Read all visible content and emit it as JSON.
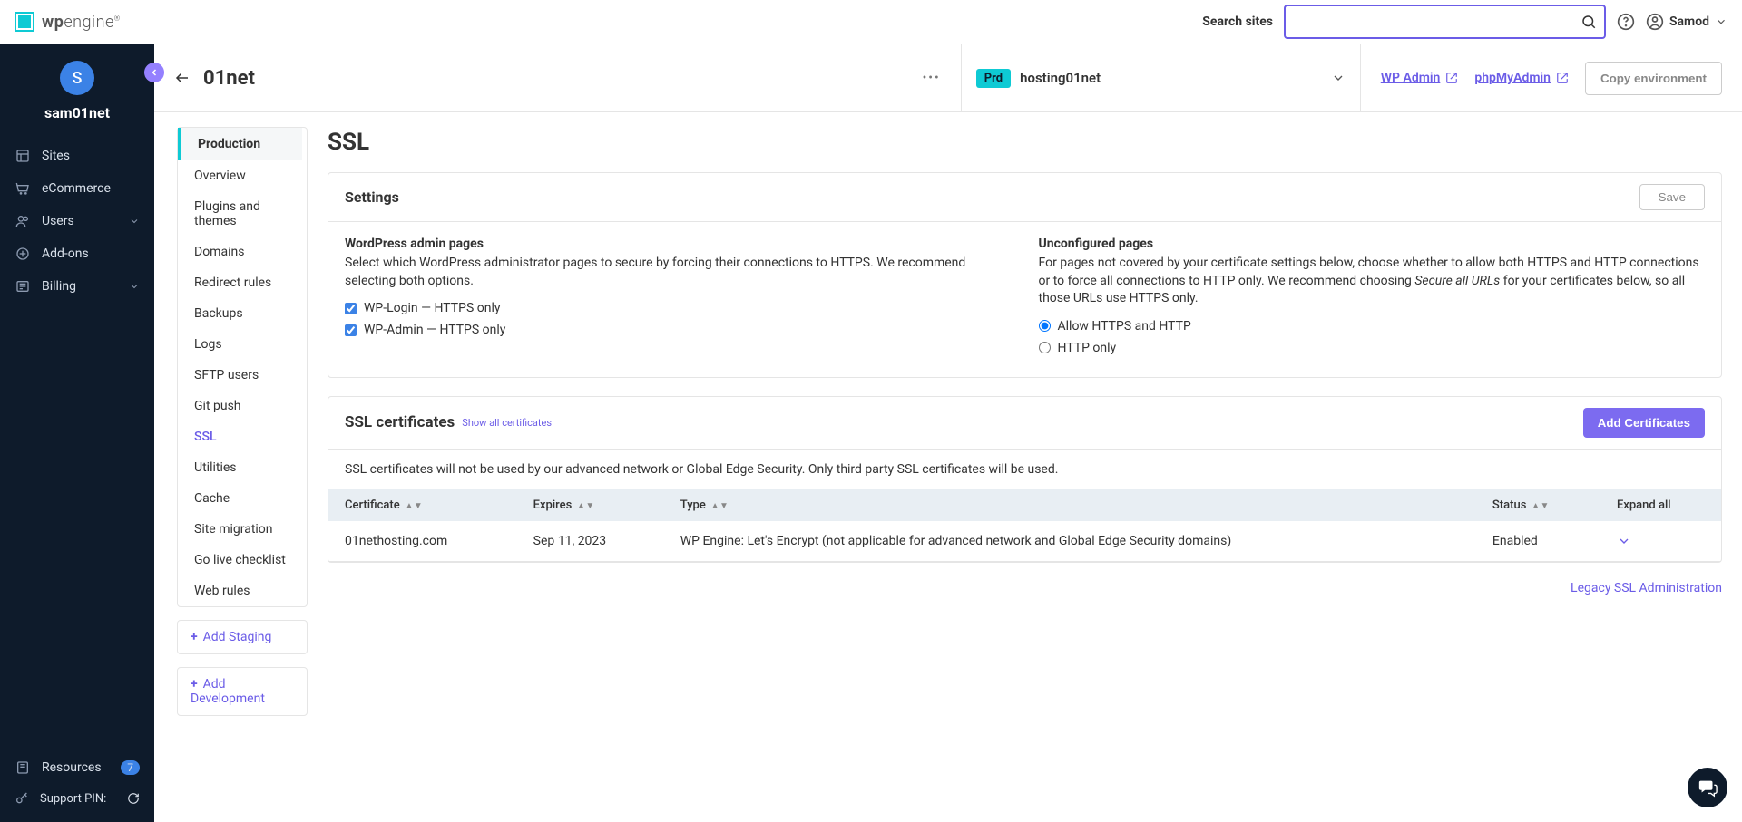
{
  "header": {
    "logo_wp": "wp",
    "logo_engine": "engine",
    "search_label": "Search sites",
    "search_placeholder": "",
    "user_name": "Samod"
  },
  "sidebar": {
    "avatar_letter": "S",
    "account": "sam01net",
    "items": [
      {
        "label": "Sites"
      },
      {
        "label": "eCommerce"
      },
      {
        "label": "Users",
        "expandable": true
      },
      {
        "label": "Add-ons"
      },
      {
        "label": "Billing",
        "expandable": true
      }
    ],
    "resources": {
      "label": "Resources",
      "badge": "7"
    },
    "support_label": "Support PIN:"
  },
  "site_header": {
    "site_name": "01net",
    "env_badge": "Prd",
    "env_name": "hosting01net",
    "wp_admin": "WP Admin",
    "phpmyadmin": "phpMyAdmin",
    "copy_env": "Copy environment"
  },
  "sub_sidebar": {
    "env_label": "Production",
    "items": [
      "Overview",
      "Plugins and themes",
      "Domains",
      "Redirect rules",
      "Backups",
      "Logs",
      "SFTP users",
      "Git push",
      "SSL",
      "Utilities",
      "Cache",
      "Site migration",
      "Go live checklist",
      "Web rules"
    ],
    "active_index": 8,
    "add_staging": "Add Staging",
    "add_development": "Add Development"
  },
  "page": {
    "title": "SSL",
    "settings": {
      "title": "Settings",
      "save": "Save",
      "wp_admin_title": "WordPress admin pages",
      "wp_admin_desc": "Select which WordPress administrator pages to secure by forcing their connections to HTTPS. We recommend selecting both options.",
      "wp_login_label": "WP-Login — HTTPS only",
      "wp_admin_label": "WP-Admin — HTTPS only",
      "unconf_title": "Unconfigured pages",
      "unconf_desc_1": "For pages not covered by your certificate settings below, choose whether to allow both HTTPS and HTTP connections or to force all connections to HTTP only. We recommend choosing ",
      "unconf_italic": "Secure all URLs",
      "unconf_desc_2": " for your certificates below, so all those URLs use HTTPS only.",
      "radio_allow": "Allow HTTPS and HTTP",
      "radio_http": "HTTP only"
    },
    "certs": {
      "title": "SSL certificates",
      "show_all": "Show all certificates",
      "add_btn": "Add Certificates",
      "note": "SSL certificates will not be used by our advanced network or Global Edge Security. Only third party SSL certificates will be used.",
      "cols": {
        "cert": "Certificate",
        "expires": "Expires",
        "type": "Type",
        "status": "Status",
        "expand": "Expand all"
      },
      "rows": [
        {
          "cert": "01nethosting.com",
          "expires": "Sep 11, 2023",
          "type": "WP Engine: Let's Encrypt (not applicable for advanced network and Global Edge Security domains)",
          "status": "Enabled"
        }
      ]
    },
    "legacy_link": "Legacy SSL Administration"
  }
}
